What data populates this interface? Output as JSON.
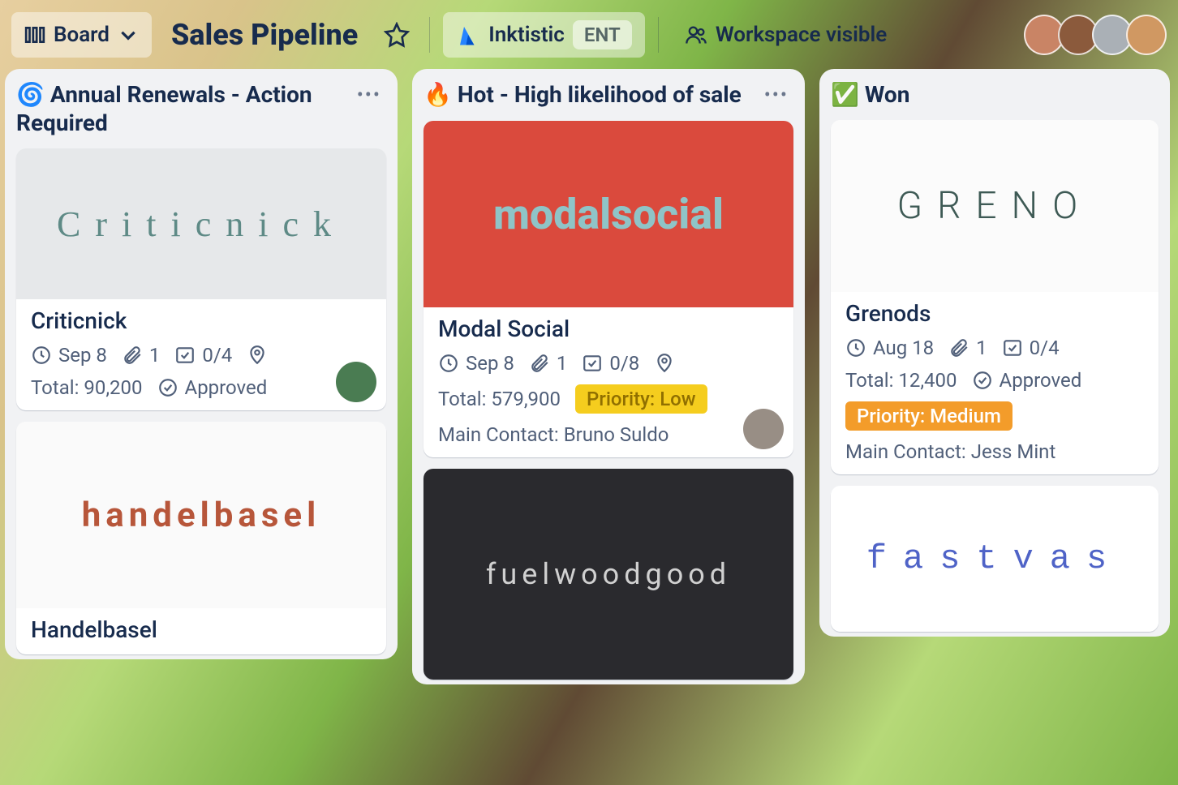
{
  "header": {
    "view_label": "Board",
    "board_title": "Sales Pipeline",
    "org_name": "Inktistic",
    "org_badge": "ENT",
    "visibility": "Workspace visible"
  },
  "lists": [
    {
      "icon": "🌀",
      "title": "Annual Renewals - Action Required",
      "cards": [
        {
          "cover_text": "Criticnick",
          "cover_class": "criticnick",
          "title": "Criticnick",
          "date": "Sep 8",
          "attachments": "1",
          "checklist": "0/4",
          "has_location": true,
          "total": "Total: 90,200",
          "status": "Approved",
          "avatar_class": "cav1"
        },
        {
          "cover_text": "handelbasel",
          "cover_class": "handelbasel",
          "title": "Handelbasel"
        }
      ]
    },
    {
      "icon": "🔥",
      "title": "Hot - High likelihood of sale",
      "cards": [
        {
          "cover_text": "modalsocial",
          "cover_class": "modalsocial",
          "title": "Modal Social",
          "date": "Sep 8",
          "attachments": "1",
          "checklist": "0/8",
          "has_location": true,
          "total": "Total: 579,900",
          "priority_label": "Priority: Low",
          "priority_class": "low",
          "contact": "Main Contact: Bruno Suldo",
          "avatar_class": "cav2"
        },
        {
          "cover_text": "fuelwoodgood",
          "cover_class": "fuelwood"
        }
      ]
    },
    {
      "icon": "✅",
      "title": "Won",
      "cards": [
        {
          "cover_text": "GRENO",
          "cover_class": "grenods",
          "title": "Grenods",
          "date": "Aug 18",
          "attachments": "1",
          "checklist": "0/4",
          "total": "Total: 12,400",
          "status": "Approved",
          "priority_label": "Priority: Medium",
          "priority_class": "med",
          "contact": "Main Contact: Jess Mint"
        },
        {
          "cover_text": "fastvas",
          "cover_class": "fastvase"
        }
      ]
    }
  ]
}
